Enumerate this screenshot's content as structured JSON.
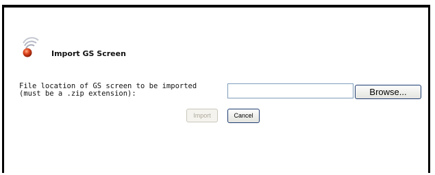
{
  "dialog": {
    "title": "Import GS Screen",
    "field_label_line1": "File location of GS screen to be imported",
    "field_label_line2": "(must be a .zip extension):",
    "file_input_value": "",
    "browse_label": "Browse...",
    "import_label": "Import",
    "cancel_label": "Cancel"
  },
  "colors": {
    "logo_orb": "#d9401c",
    "logo_arcs": "#b5b9c4",
    "input_border": "#7f9db9",
    "button_border": "#1c3b6f",
    "disabled_text": "#aca899"
  }
}
